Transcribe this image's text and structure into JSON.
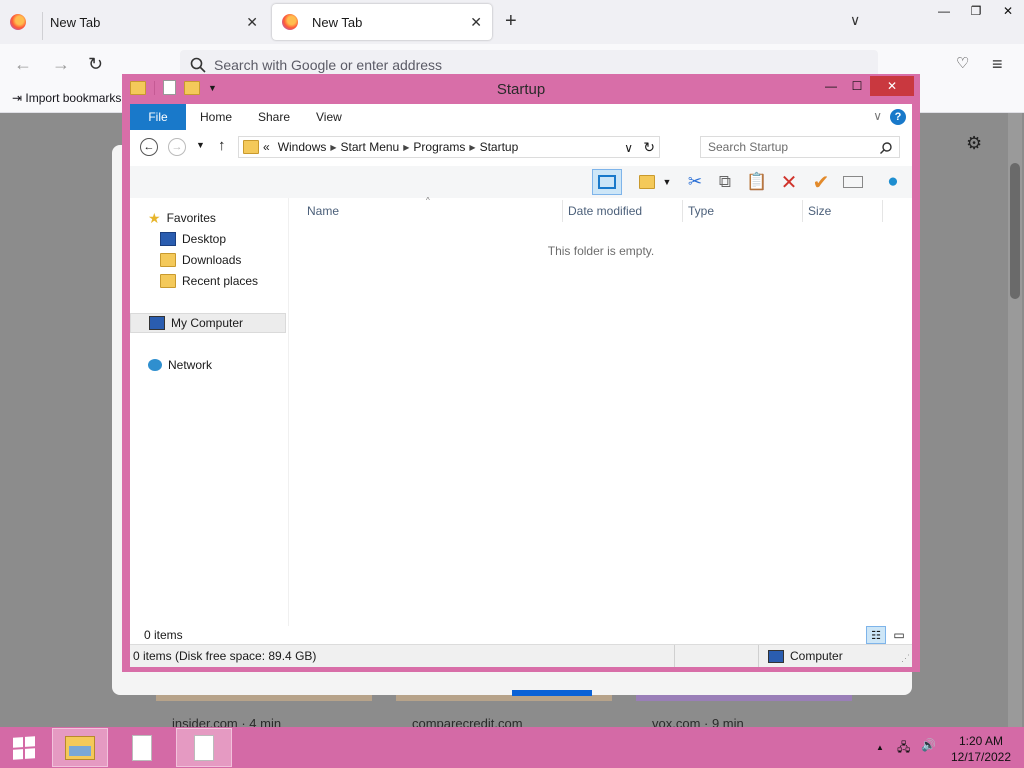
{
  "browser": {
    "tabs": [
      {
        "label": "New Tab"
      },
      {
        "label": "New Tab"
      }
    ],
    "url_placeholder": "Search with Google or enter address",
    "bookmark_item": "Import bookmarks...",
    "tiles": [
      {
        "label": "insider.com · 4 min"
      },
      {
        "label": "comparecredit.com"
      },
      {
        "label": "vox.com · 9 min"
      }
    ]
  },
  "explorer": {
    "title": "Startup",
    "ribbon_tabs": [
      "File",
      "Home",
      "Share",
      "View"
    ],
    "breadcrumb": [
      "Windows",
      "Start Menu",
      "Programs",
      "Startup"
    ],
    "breadcrumb_prefix": "«",
    "search_placeholder": "Search Startup",
    "nav": {
      "favorites": "Favorites",
      "desktop": "Desktop",
      "downloads": "Downloads",
      "recent": "Recent places",
      "computer": "My Computer",
      "network": "Network"
    },
    "columns": [
      "Name",
      "Date modified",
      "Type",
      "Size"
    ],
    "empty_message": "This folder is empty.",
    "item_count": "0 items",
    "status_text": "0 items (Disk free space: 89.4 GB)",
    "status_location": "Computer"
  },
  "taskbar": {
    "time": "1:20 AM",
    "date": "12/17/2022"
  },
  "colors": {
    "window_frame": "#d86ea8",
    "taskbar": "#d46aa6",
    "file_tab": "#1979ca",
    "close_button": "#c9383f"
  }
}
